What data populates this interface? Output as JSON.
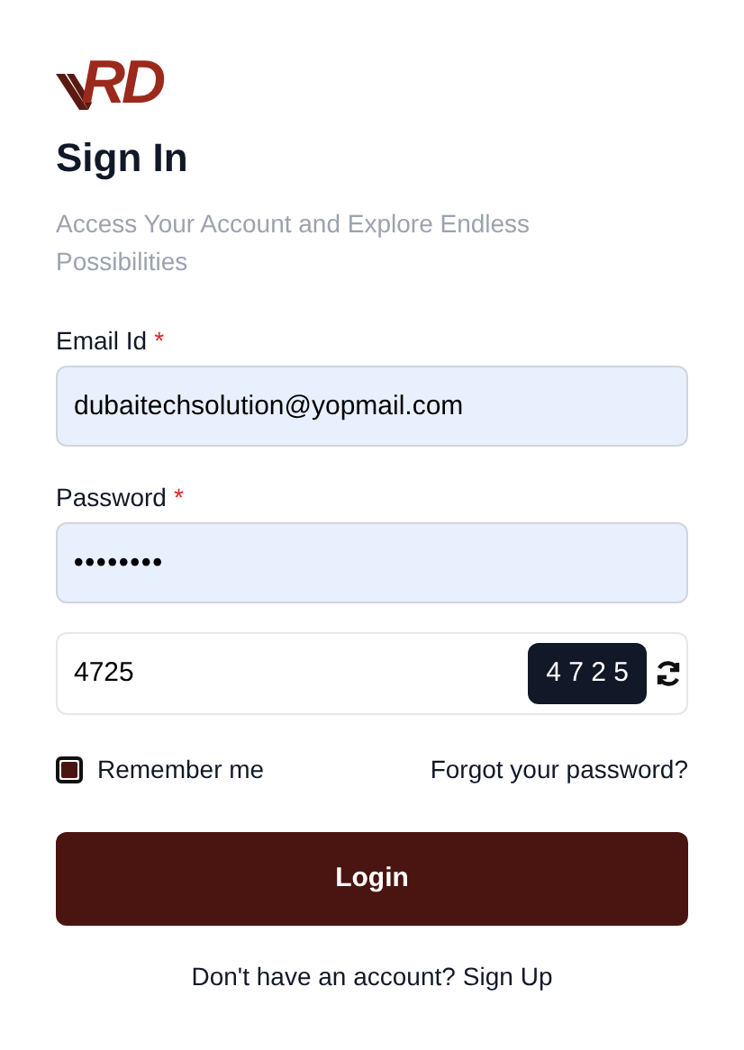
{
  "logo": {
    "text": "RD"
  },
  "title": "Sign In",
  "subtitle": "Access Your Account and Explore Endless Possibilities",
  "fields": [
    {
      "label": "Email Id",
      "required_mark": "*",
      "value": "dubaitechsolution@yopmail.com",
      "kind": "text"
    },
    {
      "label": "Password",
      "required_mark": "*",
      "value": "••••••••",
      "kind": "password"
    }
  ],
  "captcha": {
    "value": "4725",
    "code": "4 7 2 5"
  },
  "remember": {
    "label": "Remember me",
    "checked": true
  },
  "forgot_link": "Forgot your password?",
  "login_button": "Login",
  "signup": {
    "text": "Don't have an account?",
    "link": "Sign Up"
  }
}
